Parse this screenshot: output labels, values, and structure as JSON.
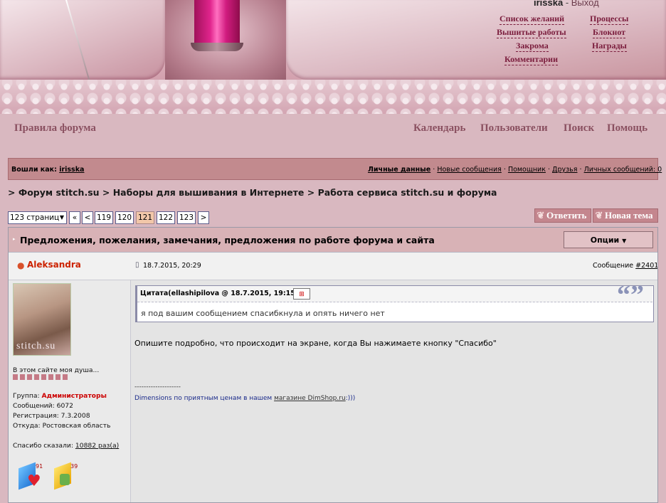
{
  "header": {
    "user_name": "irisska",
    "user_sep": " - ",
    "logout": "Выход",
    "links": {
      "wishlist": "Список желаний",
      "processes": "Процессы",
      "embroidered": "Вышитые работы",
      "notepad": "Блокнот",
      "stash": "Закрома",
      "awards": "Награды",
      "comments": "Комментарии"
    }
  },
  "nav": {
    "rules": "Правила форума",
    "calendar": "Календарь",
    "users": "Пользователи",
    "search": "Поиск",
    "help": "Помощь"
  },
  "userbar": {
    "logged_as": "Вошли как:",
    "user": "irisska",
    "links": [
      "Личные данные",
      "Новые сообщения",
      "Помощник",
      "Друзья",
      "Личных сообщений: 0"
    ],
    "sep": "·"
  },
  "breadcrumb": "> Форум stitch.su > Наборы для вышивания в Интернете > Работа сервиса stitch.su и форума",
  "pagination": {
    "pages_select": "123 страниц",
    "first": "«",
    "prev": "<",
    "pages": [
      "119",
      "120",
      "121",
      "122",
      "123"
    ],
    "current": "121",
    "next": ">"
  },
  "actions": {
    "reply": "Ответить",
    "new_topic": "Новая тема"
  },
  "topic": {
    "title": "Предложения, пожелания, замечания, предложения по работе форума и сайта",
    "options": "Опции"
  },
  "post": {
    "author": "Aleksandra",
    "date": "18.7.2015, 20:29",
    "number_label": "Сообщение ",
    "number": "#2401",
    "avatar_text": "stitch.su",
    "motto": "В этом сайте моя душа...",
    "group_label": "Группа: ",
    "group": "Администраторы",
    "messages": "Сообщений: 6072",
    "registered": "Регистрация: 7.3.2008",
    "from": "Откуда: Ростовская область",
    "thanks_label": "Спасибо сказали: ",
    "thanks_link": "10882 раз(а)",
    "badge1": "91",
    "badge2": "39",
    "quote_head": "Цитата(ellashipilova @ 18.7.2015, 19:15)",
    "quote_text": "я под вашим сообщением спасибкнула и опять ничего нет",
    "body": "Опишите подробно, что происходит на экране, когда Вы нажимаете кнопку \"Спасибо\"",
    "sig_sep": "--------------------",
    "sig_pre": "Dimensions по приятным ценам в нашем ",
    "sig_link": "магазине DimShop.ru",
    "sig_post": ":)))"
  },
  "colors": {
    "accent": "#7a1c3c",
    "admin_group": "#cc0000",
    "current_page": "#f2c7a9",
    "bar": "#c28a8e"
  }
}
